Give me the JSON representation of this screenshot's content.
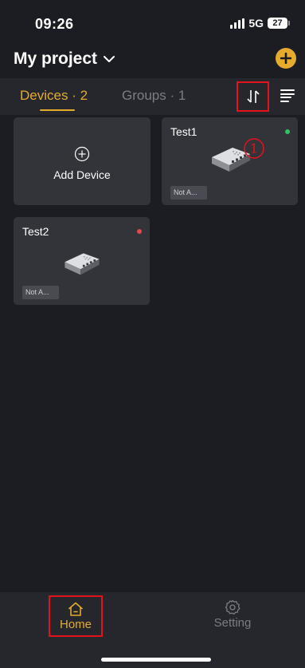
{
  "status_bar": {
    "time": "09:26",
    "network": "5G",
    "battery_level": "27"
  },
  "header": {
    "project_title": "My project"
  },
  "tabs": {
    "devices": {
      "label": "Devices",
      "count": "2",
      "display": "Devices · 2"
    },
    "groups": {
      "label": "Groups",
      "count": "1",
      "display": "Groups · 1"
    }
  },
  "add_device": {
    "label": "Add Device"
  },
  "devices": [
    {
      "name": "Test1",
      "tag": "Not A...",
      "status_color": "#2ec264"
    },
    {
      "name": "Test2",
      "tag": "Not A...",
      "status_color": "#e04a4a"
    }
  ],
  "annotation": {
    "callout": "①"
  },
  "bottom_nav": {
    "home_label": "Home",
    "setting_label": "Setting"
  },
  "colors": {
    "accent": "#e4ab2d",
    "highlight_box": "#e3121c",
    "background": "#1c1d22",
    "card": "#33343a",
    "inactive": "#7c7c82"
  }
}
